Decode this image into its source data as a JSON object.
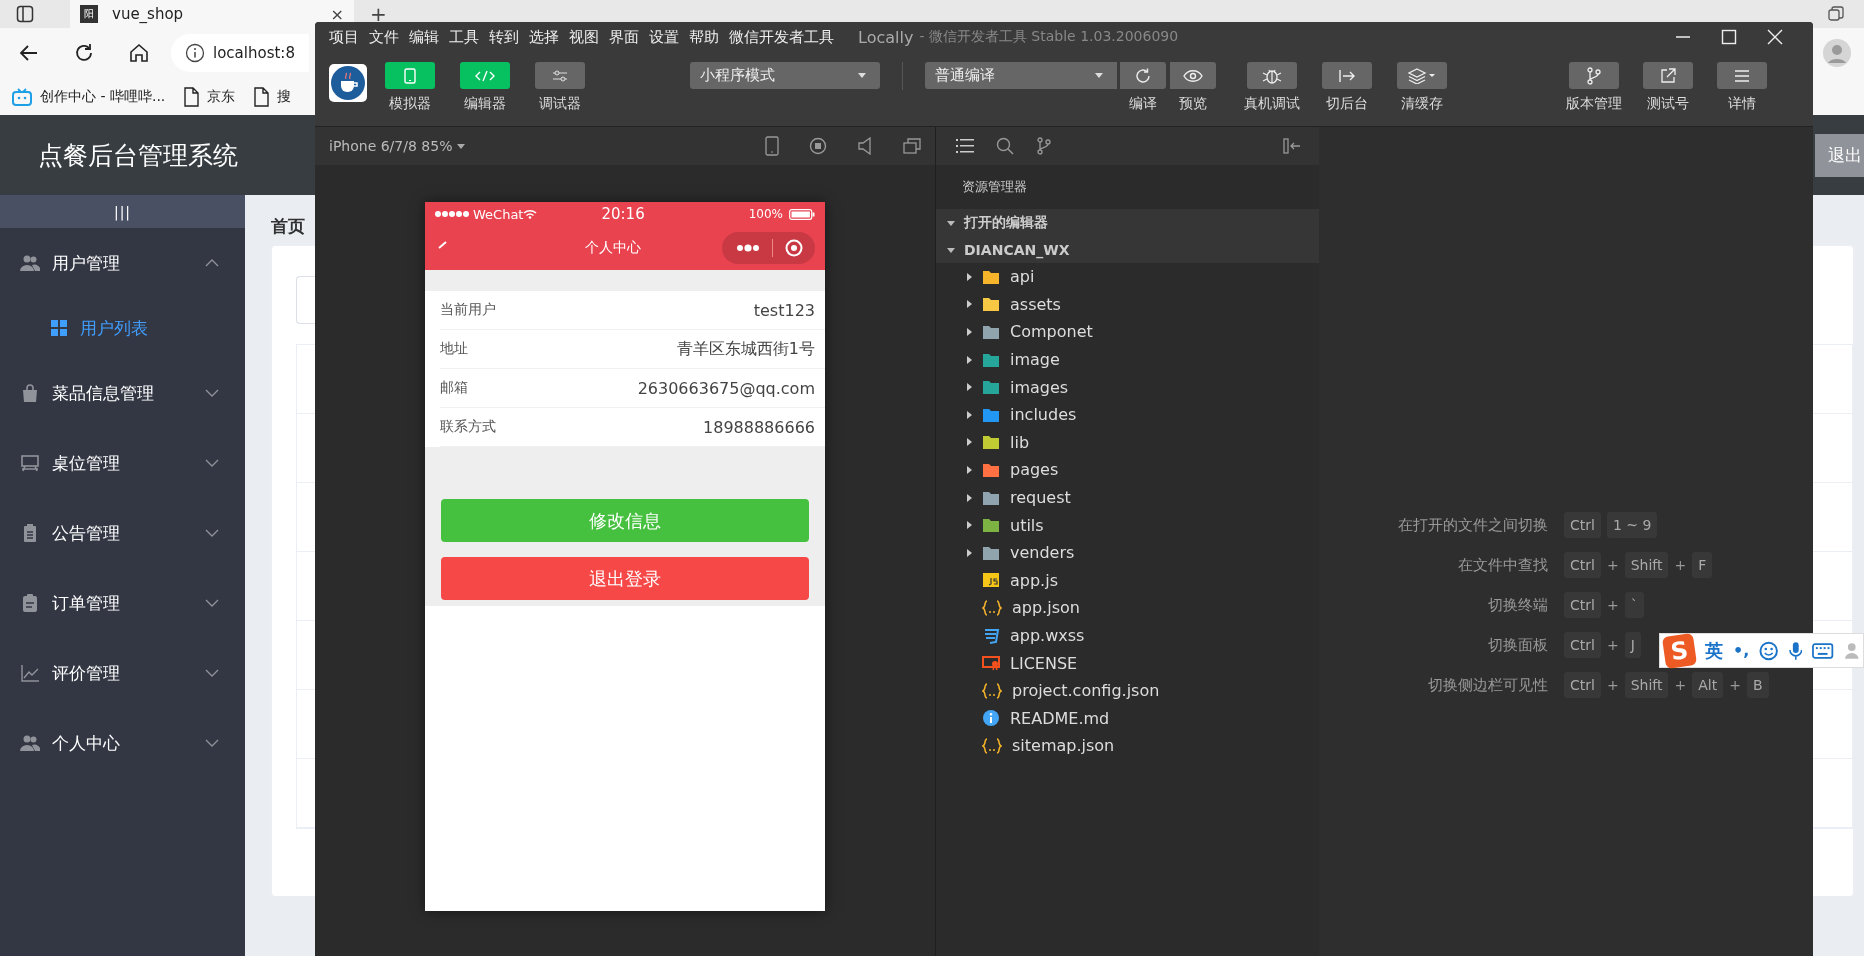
{
  "browser": {
    "tab": {
      "favicon": "阳",
      "title": "vue_shop",
      "close": "×"
    },
    "new_tab": "+",
    "address": "localhost:8",
    "bookmarks": [
      {
        "kind": "bilibili",
        "label": "创作中心 - 哔哩哔..."
      },
      {
        "kind": "page",
        "label": "京东"
      },
      {
        "kind": "page",
        "label": "搜"
      }
    ]
  },
  "app": {
    "title": "点餐后台管理系统",
    "toggle": "|||",
    "logout": "退出",
    "breadcrumb": "首页",
    "menu": [
      {
        "kind": "users",
        "label": "用户管理",
        "expanded": true,
        "children": [
          {
            "label": "用户列表",
            "selected": true
          }
        ]
      },
      {
        "kind": "bag",
        "label": "菜品信息管理",
        "expanded": false
      },
      {
        "kind": "easel",
        "label": "桌位管理",
        "expanded": false
      },
      {
        "kind": "clipboard",
        "label": "公告管理",
        "expanded": false
      },
      {
        "kind": "order",
        "label": "订单管理",
        "expanded": false
      },
      {
        "kind": "chart",
        "label": "评价管理",
        "expanded": false
      },
      {
        "kind": "users",
        "label": "个人中心",
        "expanded": false
      }
    ]
  },
  "devtools": {
    "menu": [
      "项目",
      "文件",
      "编辑",
      "工具",
      "转到",
      "选择",
      "视图",
      "界面",
      "设置",
      "帮助",
      "微信开发者工具"
    ],
    "title": "Locally",
    "subtitle": "- 微信开发者工具 Stable 1.03.2006090",
    "view_buttons": [
      {
        "kind": "simulator",
        "label": "模拟器",
        "selected": true
      },
      {
        "kind": "editor",
        "label": "编辑器",
        "selected": true
      },
      {
        "kind": "debugger",
        "label": "调试器",
        "selected": false
      }
    ],
    "mode_select": "小程序模式",
    "compile_select": "普通编译",
    "compile_actions": [
      {
        "kind": "compile",
        "label": "编译"
      },
      {
        "kind": "preview",
        "label": "预览"
      }
    ],
    "mid_actions": [
      {
        "kind": "bug",
        "label": "真机调试"
      },
      {
        "kind": "background",
        "label": "切后台"
      },
      {
        "kind": "layers",
        "label": "清缓存"
      }
    ],
    "right_actions": [
      {
        "kind": "branch",
        "label": "版本管理"
      },
      {
        "kind": "external",
        "label": "测试号"
      },
      {
        "kind": "menu",
        "label": "详情"
      }
    ],
    "simulator": {
      "device": "iPhone 6/7/8 85%",
      "phone": {
        "carrier": "WeChat",
        "time": "20:16",
        "battery": "100%",
        "nav_title": "个人中心",
        "rows": [
          {
            "label": "当前用户",
            "value": "test123"
          },
          {
            "label": "地址",
            "value": "青羊区东城西街1号"
          },
          {
            "label": "邮箱",
            "value": "2630663675@qq.com"
          },
          {
            "label": "联系方式",
            "value": "18988886666"
          }
        ],
        "buttons": [
          {
            "kind": "primary",
            "label": "修改信息"
          },
          {
            "kind": "danger",
            "label": "退出登录"
          }
        ]
      }
    },
    "explorer": {
      "title": "资源管理器",
      "sections": [
        {
          "label": "打开的编辑器",
          "expanded": true
        },
        {
          "label": "DIANCAN_WX",
          "expanded": true,
          "children": [
            {
              "kind": "folder",
              "label": "api",
              "color": "#f5b42a",
              "expanded": false
            },
            {
              "kind": "folder",
              "label": "assets",
              "color": "#f7c844",
              "expanded": false
            },
            {
              "kind": "folder",
              "label": "Componet",
              "color": "#90a4ae",
              "expanded": false
            },
            {
              "kind": "folder",
              "label": "image",
              "color": "#26a69a",
              "expanded": false
            },
            {
              "kind": "folder",
              "label": "images",
              "color": "#26a69b",
              "expanded": false
            },
            {
              "kind": "folder",
              "label": "includes",
              "color": "#2196f3",
              "expanded": false
            },
            {
              "kind": "folder",
              "label": "lib",
              "color": "#c0ca33",
              "expanded": false
            },
            {
              "kind": "folder",
              "label": "pages",
              "color": "#ff7043",
              "expanded": false
            },
            {
              "kind": "folder",
              "label": "request",
              "color": "#90a4af",
              "expanded": false
            },
            {
              "kind": "folder",
              "label": "utils",
              "color": "#7cb342",
              "expanded": false
            },
            {
              "kind": "folder",
              "label": "venders",
              "color": "#90a4ad",
              "expanded": false
            },
            {
              "kind": "js",
              "label": "app.js"
            },
            {
              "kind": "json",
              "label": "app.json"
            },
            {
              "kind": "css",
              "label": "app.wxss"
            },
            {
              "kind": "license",
              "label": "LICENSE"
            },
            {
              "kind": "json",
              "label": "project.config.json"
            },
            {
              "kind": "info",
              "label": "README.md"
            },
            {
              "kind": "json",
              "label": "sitemap.json"
            }
          ]
        }
      ]
    },
    "shortcuts": [
      {
        "label": "在打开的文件之间切换",
        "keys": [
          {
            "kind": "key",
            "text": "Ctrl"
          },
          {
            "kind": "key",
            "text": "1 ~ 9"
          }
        ]
      },
      {
        "label": "在文件中查找",
        "keys": [
          {
            "kind": "key",
            "text": "Ctrl"
          },
          {
            "kind": "plus",
            "text": "+"
          },
          {
            "kind": "key",
            "text": "Shift"
          },
          {
            "kind": "plus",
            "text": "+"
          },
          {
            "kind": "key",
            "text": "F"
          }
        ]
      },
      {
        "label": "切换终端",
        "keys": [
          {
            "kind": "key",
            "text": "Ctrl"
          },
          {
            "kind": "plus",
            "text": "+"
          },
          {
            "kind": "key",
            "text": "`"
          }
        ]
      },
      {
        "label": "切换面板",
        "keys": [
          {
            "kind": "key",
            "text": "Ctrl"
          },
          {
            "kind": "plus",
            "text": "+"
          },
          {
            "kind": "key",
            "text": "J"
          }
        ]
      },
      {
        "label": "切换侧边栏可见性",
        "keys": [
          {
            "kind": "key",
            "text": "Ctrl"
          },
          {
            "kind": "plus",
            "text": "+"
          },
          {
            "kind": "key",
            "text": "Shift"
          },
          {
            "kind": "plus",
            "text": "+"
          },
          {
            "kind": "key",
            "text": "Alt"
          },
          {
            "kind": "plus",
            "text": "+"
          },
          {
            "kind": "key",
            "text": "B"
          }
        ]
      }
    ]
  },
  "ime": {
    "logo": "S",
    "mode": "英",
    "punct": "•,"
  }
}
